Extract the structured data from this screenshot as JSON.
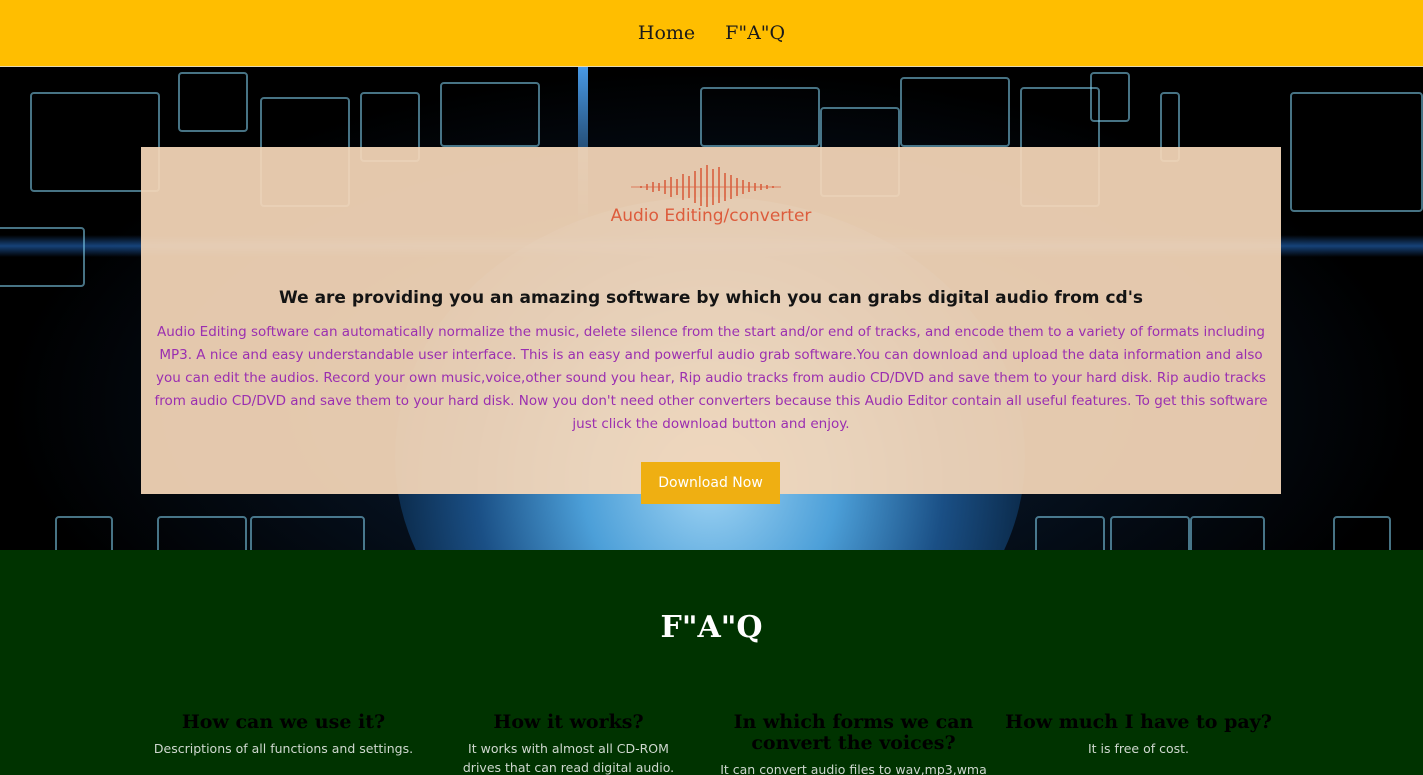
{
  "nav": {
    "items": [
      {
        "label": "Home"
      },
      {
        "label": "F\"A\"Q"
      }
    ]
  },
  "hero": {
    "logo_text": "Audio Editing/converter",
    "headline": "We are providing you an amazing software by which you can grabs digital audio from cd's",
    "description": "Audio Editing software can automatically normalize the music, delete silence from the start and/or end of tracks, and encode them to a variety of formats including MP3. A nice and easy understandable user interface. This is an easy and powerful audio grab software.You can download and upload the data information and also you can edit the audios. Record your own music,voice,other sound you hear, Rip audio tracks from audio CD/DVD and save them to your hard disk. Rip audio tracks from audio CD/DVD and save them to your hard disk. Now you don't need other converters because this Audio Editor contain all useful features. To get this software just click the download button and enjoy.",
    "download_label": "Download Now"
  },
  "faq": {
    "title": "F\"A\"Q",
    "items": [
      {
        "question": "How can we use it?",
        "answer": "Descriptions of all functions and settings."
      },
      {
        "question": "How it works?",
        "answer": "It works with almost all CD-ROM drives that can read digital audio."
      },
      {
        "question": "In which forms we can convert the voices?",
        "answer": "It can convert audio files to wav,mp3,wma"
      },
      {
        "question": "How much I have to pay?",
        "answer": "It is free of cost."
      }
    ]
  },
  "colors": {
    "nav_bg": "#ffbe00",
    "panel_bg": "#f5d7b9",
    "description_text": "#9b2fb0",
    "button_bg": "#efaf12",
    "faq_bg": "#003300"
  },
  "icons": {
    "logo": "audio-waveform-icon"
  }
}
